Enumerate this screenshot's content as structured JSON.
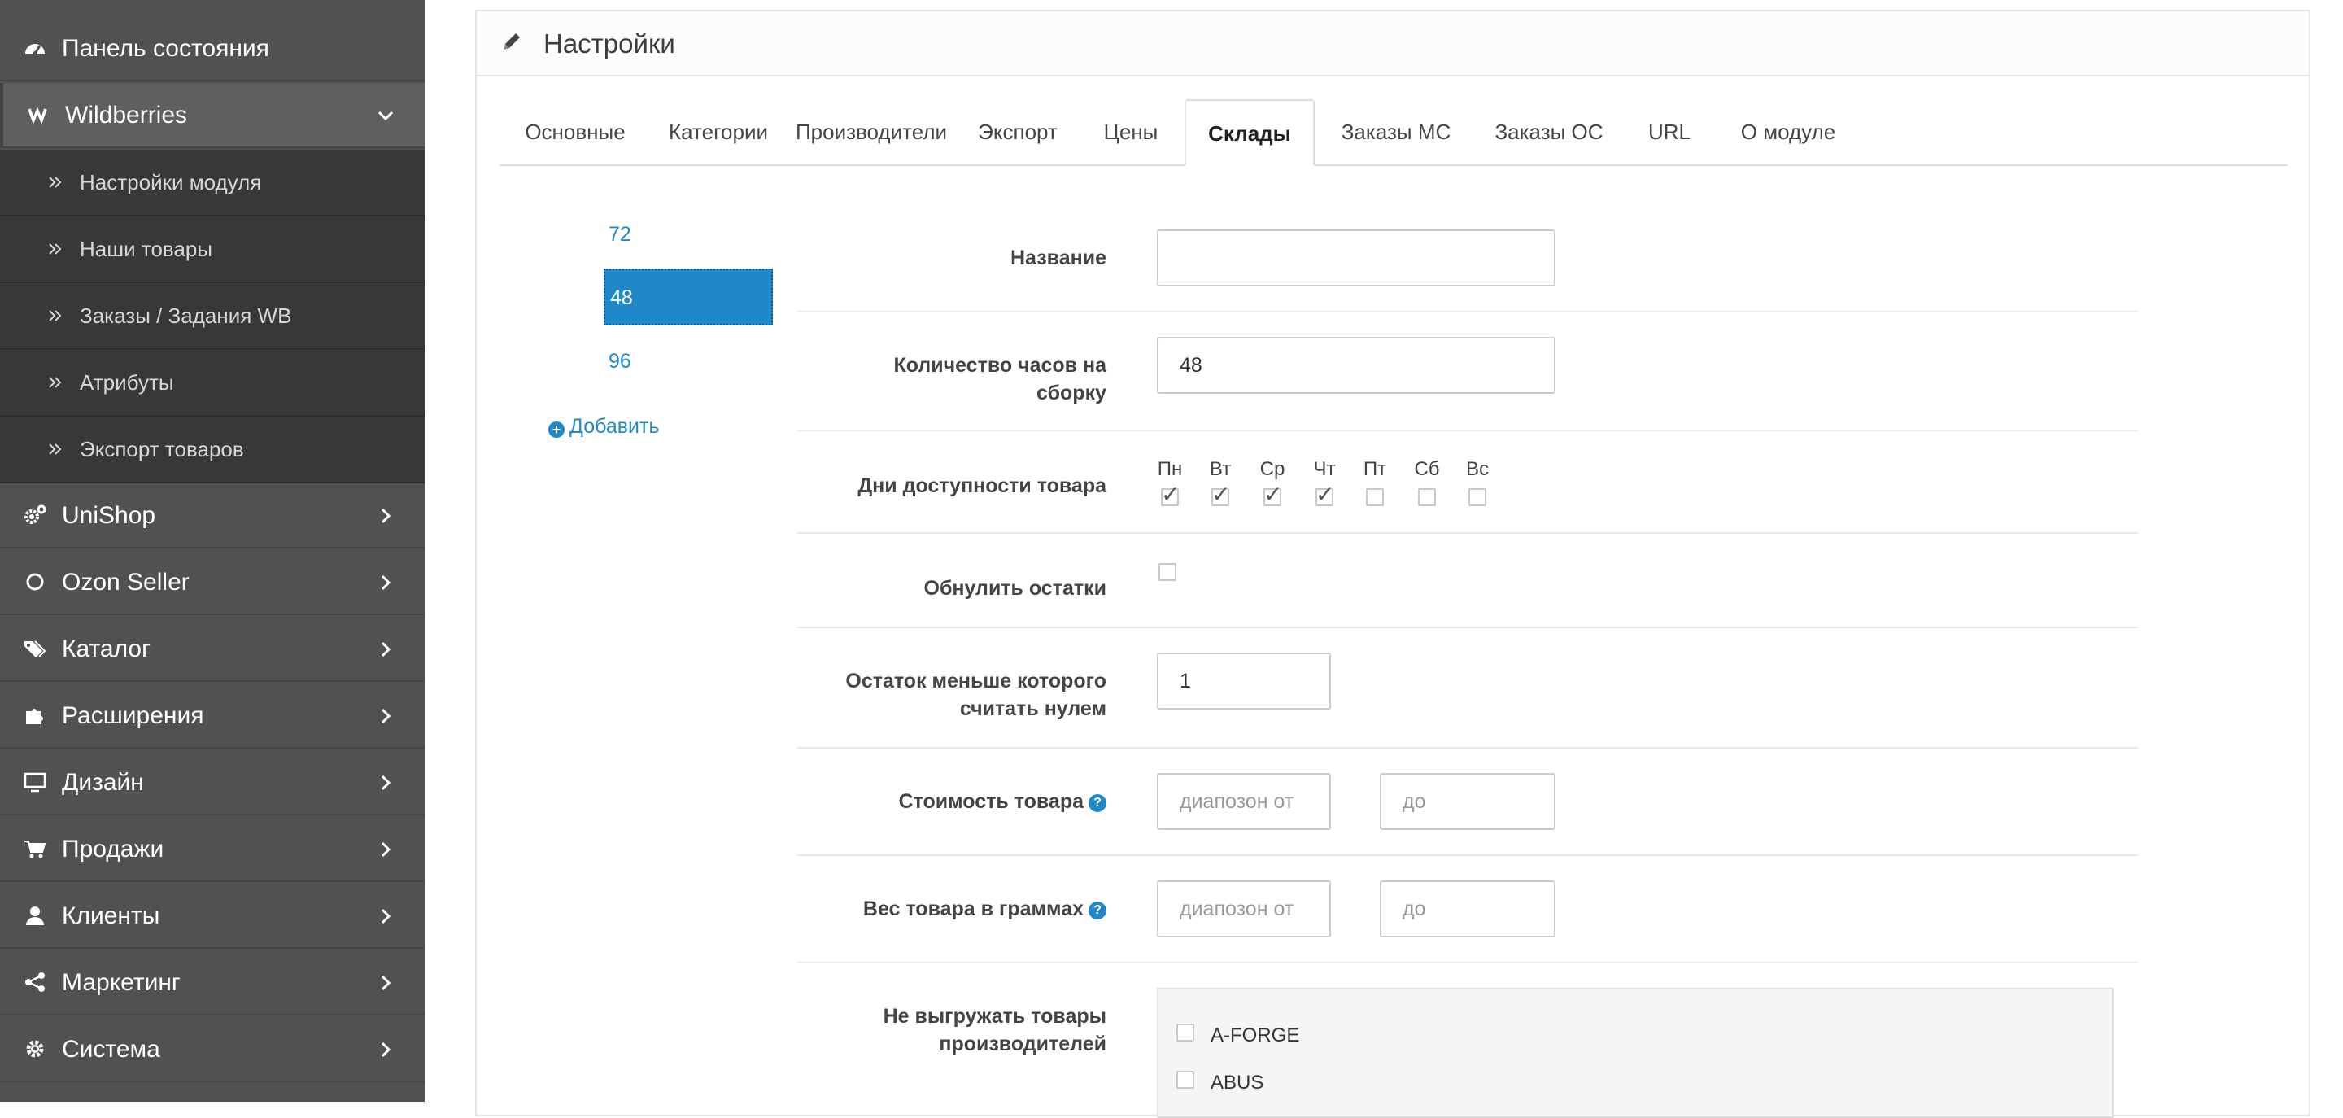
{
  "sidebar": {
    "items": [
      {
        "label": "Панель состояния",
        "icon": "dashboard-icon"
      },
      {
        "label": "Wildberries",
        "icon": "wildberries-icon",
        "expanded": true
      },
      {
        "label": "UniShop",
        "icon": "gears-icon"
      },
      {
        "label": "Ozon Seller",
        "icon": "circle-icon"
      },
      {
        "label": "Каталог",
        "icon": "tags-icon"
      },
      {
        "label": "Расширения",
        "icon": "puzzle-icon"
      },
      {
        "label": "Дизайн",
        "icon": "monitor-icon"
      },
      {
        "label": "Продажи",
        "icon": "cart-icon"
      },
      {
        "label": "Клиенты",
        "icon": "user-icon"
      },
      {
        "label": "Маркетинг",
        "icon": "share-icon"
      },
      {
        "label": "Система",
        "icon": "cog-icon"
      }
    ],
    "submenu": [
      {
        "label": "Настройки модуля"
      },
      {
        "label": "Наши товары"
      },
      {
        "label": "Заказы / Задания WB"
      },
      {
        "label": "Атрибуты"
      },
      {
        "label": "Экспорт товаров"
      }
    ]
  },
  "panel": {
    "title": "Настройки",
    "tabs": [
      {
        "label": "Основные"
      },
      {
        "label": "Категории"
      },
      {
        "label": "Производители"
      },
      {
        "label": "Экспорт"
      },
      {
        "label": "Цены"
      },
      {
        "label": "Склады",
        "active": true
      },
      {
        "label": "Заказы МС"
      },
      {
        "label": "Заказы ОС"
      },
      {
        "label": "URL"
      },
      {
        "label": "О модуле"
      }
    ]
  },
  "warehouses": {
    "items": [
      "72",
      "48",
      "96"
    ],
    "selected": "48",
    "add_label": "Добавить"
  },
  "form": {
    "name_label": "Название",
    "name_value": "",
    "hours_label_line1": "Количество часов на",
    "hours_label_line2": "сборку",
    "hours_value": "48",
    "days_label": "Дни доступности товара",
    "days": [
      {
        "label": "Пн",
        "checked": true
      },
      {
        "label": "Вт",
        "checked": true
      },
      {
        "label": "Ср",
        "checked": true
      },
      {
        "label": "Чт",
        "checked": true
      },
      {
        "label": "Пт",
        "checked": false
      },
      {
        "label": "Сб",
        "checked": false
      },
      {
        "label": "Вс",
        "checked": false
      }
    ],
    "reset_label": "Обнулить остатки",
    "reset_checked": false,
    "threshold_label_line1": "Остаток меньше которого",
    "threshold_label_line2": "считать нулем",
    "threshold_value": "1",
    "price_label": "Стоимость товара",
    "price_from_placeholder": "диапозон от",
    "price_to_placeholder": "до",
    "weight_label": "Вес товара в граммах",
    "weight_from_placeholder": "диапозон от",
    "weight_to_placeholder": "до",
    "exclude_label_line1": "Не выгружать товары",
    "exclude_label_line2": "производителей",
    "brands": [
      {
        "name": "A-FORGE",
        "checked": false
      },
      {
        "name": "ABUS",
        "checked": false
      }
    ]
  },
  "colors": {
    "sidebar_bg": "#515151",
    "submenu_bg": "#383838",
    "accent": "#1e88c8"
  }
}
